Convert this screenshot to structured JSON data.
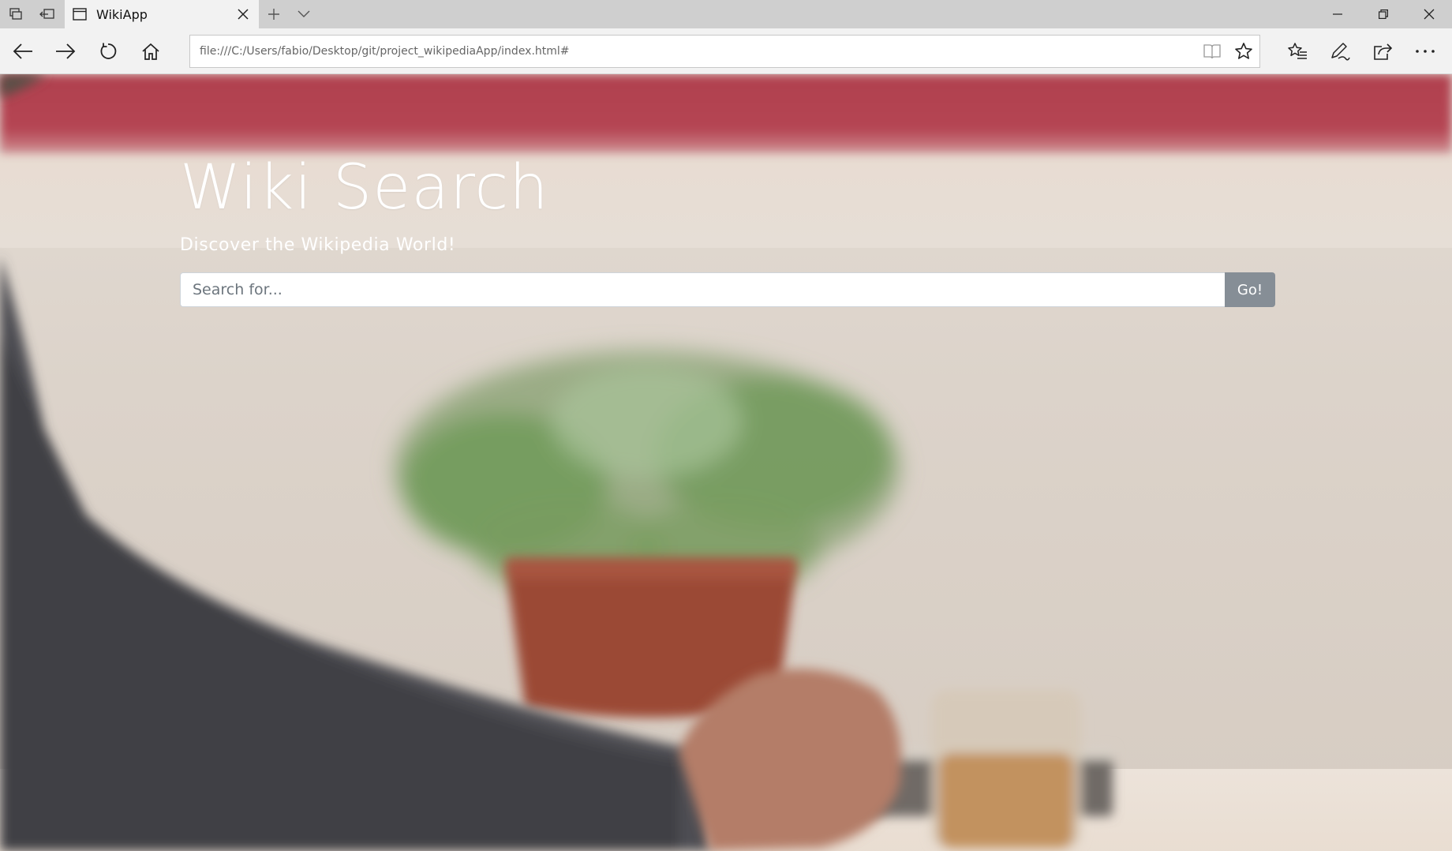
{
  "tab": {
    "title": "WikiApp"
  },
  "address_bar": {
    "url": "file:///C:/Users/fabio/Desktop/git/project_wikipediaApp/index.html#"
  },
  "page": {
    "title": "Wiki Search",
    "subtitle": "Discover the Wikipedia World!",
    "search": {
      "placeholder": "Search for...",
      "value": ""
    },
    "go_label": "Go!"
  },
  "icons": {
    "tab_preview": "tabs-aside-icon",
    "set_aside": "set-aside-icon",
    "tab_page": "page-icon",
    "tab_close": "close-icon",
    "new_tab": "plus-icon",
    "tab_list": "chevron-down-icon",
    "minimize": "minimize-icon",
    "restore": "restore-icon",
    "window_close": "close-icon",
    "back": "arrow-left-icon",
    "forward": "arrow-right-icon",
    "refresh": "refresh-icon",
    "home": "home-icon",
    "reading_view": "book-icon",
    "favorite": "star-icon",
    "favorites_hub": "favorites-list-icon",
    "web_note": "pen-icon",
    "share": "share-icon",
    "more": "more-icon"
  },
  "colors": {
    "go_button": "#868e96",
    "hero_text": "#ffffff"
  }
}
